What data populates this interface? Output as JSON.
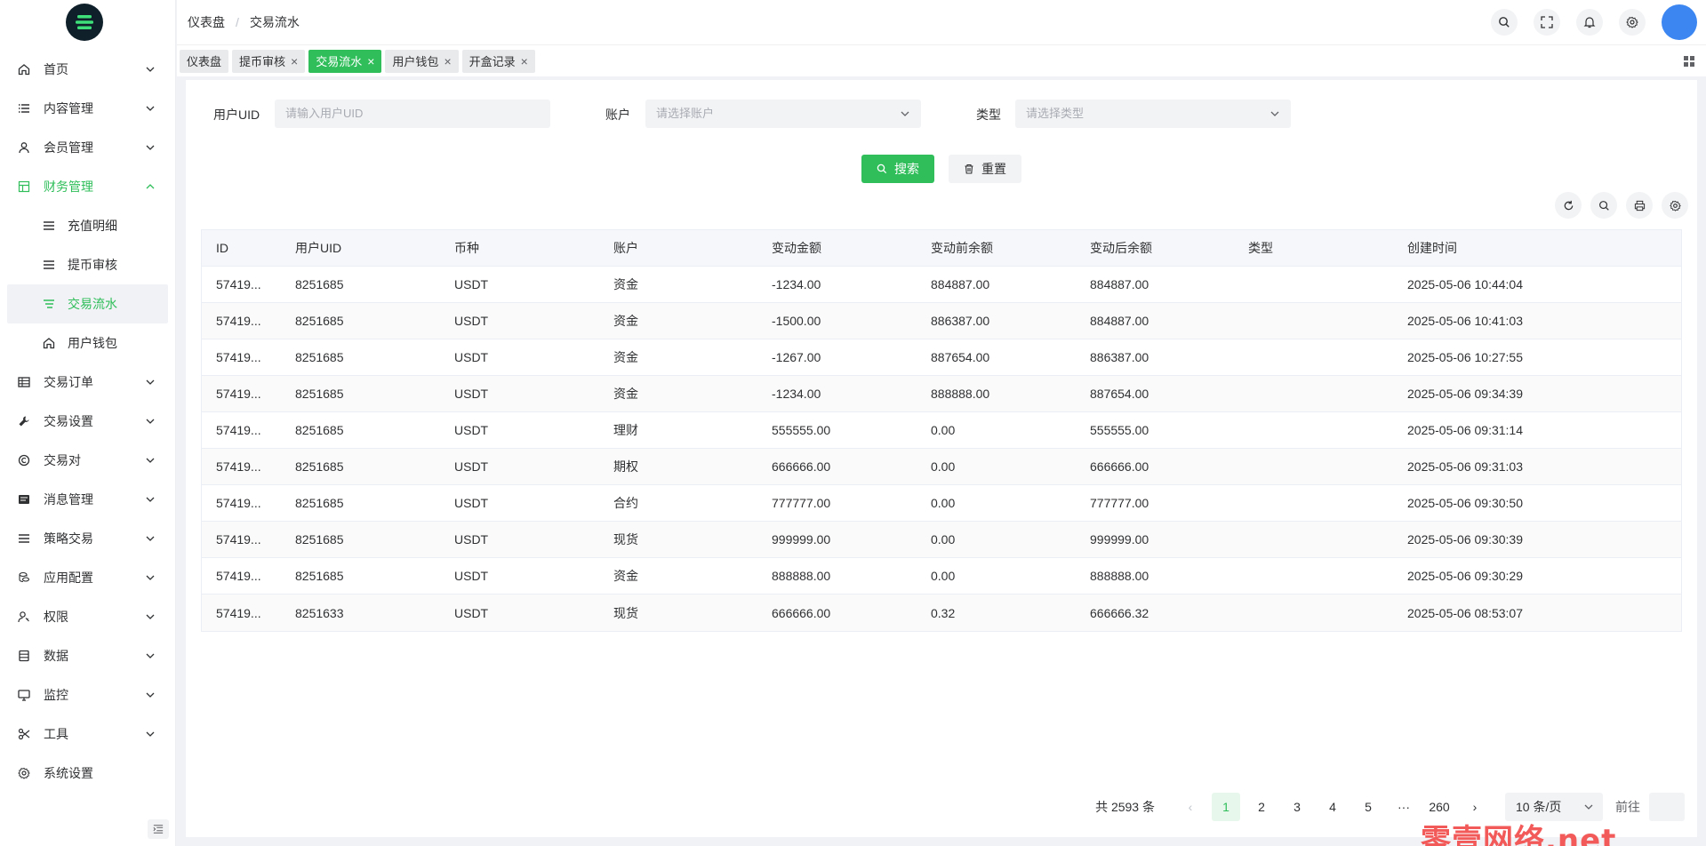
{
  "sidebar": {
    "menu": [
      {
        "label": "首页",
        "icon": "home-icon",
        "expanded": false
      },
      {
        "label": "内容管理",
        "icon": "list-icon",
        "expanded": false
      },
      {
        "label": "会员管理",
        "icon": "user-icon",
        "expanded": false
      },
      {
        "label": "财务管理",
        "icon": "finance-icon",
        "expanded": true,
        "active": true,
        "children": [
          {
            "label": "充值明细",
            "icon": "menu-lines-icon"
          },
          {
            "label": "提币审核",
            "icon": "menu-lines-icon"
          },
          {
            "label": "交易流水",
            "icon": "menu-lines-icon",
            "active": true
          },
          {
            "label": "用户钱包",
            "icon": "home-icon"
          }
        ]
      },
      {
        "label": "交易订单",
        "icon": "table-icon",
        "expanded": false
      },
      {
        "label": "交易设置",
        "icon": "wrench-icon",
        "expanded": false
      },
      {
        "label": "交易对",
        "icon": "copyright-icon",
        "expanded": false
      },
      {
        "label": "消息管理",
        "icon": "message-icon",
        "expanded": false
      },
      {
        "label": "策略交易",
        "icon": "lines-icon",
        "expanded": false
      },
      {
        "label": "应用配置",
        "icon": "coins-icon",
        "expanded": false
      },
      {
        "label": "权限",
        "icon": "user-key-icon",
        "expanded": false
      },
      {
        "label": "数据",
        "icon": "database-icon",
        "expanded": false
      },
      {
        "label": "监控",
        "icon": "monitor-icon",
        "expanded": false
      },
      {
        "label": "工具",
        "icon": "scissors-icon",
        "expanded": false
      },
      {
        "label": "系统设置",
        "icon": "gear-icon",
        "expanded": null
      }
    ]
  },
  "header": {
    "breadcrumb": [
      "仪表盘",
      "交易流水"
    ]
  },
  "tags": [
    {
      "label": "仪表盘",
      "closable": false,
      "active": false
    },
    {
      "label": "提币审核",
      "closable": true,
      "active": false
    },
    {
      "label": "交易流水",
      "closable": true,
      "active": true
    },
    {
      "label": "用户钱包",
      "closable": true,
      "active": false
    },
    {
      "label": "开盒记录",
      "closable": true,
      "active": false
    }
  ],
  "filters": {
    "uid_label": "用户UID",
    "uid_placeholder": "请输入用户UID",
    "account_label": "账户",
    "account_placeholder": "请选择账户",
    "type_label": "类型",
    "type_placeholder": "请选择类型",
    "search_label": "搜索",
    "reset_label": "重置"
  },
  "table": {
    "columns": [
      "ID",
      "用户UID",
      "币种",
      "账户",
      "变动金额",
      "变动前余额",
      "变动后余额",
      "类型",
      "创建时间"
    ],
    "rows": [
      [
        "57419...",
        "8251685",
        "USDT",
        "资金",
        "-1234.00",
        "884887.00",
        "884887.00",
        "",
        "2025-05-06 10:44:04"
      ],
      [
        "57419...",
        "8251685",
        "USDT",
        "资金",
        "-1500.00",
        "886387.00",
        "884887.00",
        "",
        "2025-05-06 10:41:03"
      ],
      [
        "57419...",
        "8251685",
        "USDT",
        "资金",
        "-1267.00",
        "887654.00",
        "886387.00",
        "",
        "2025-05-06 10:27:55"
      ],
      [
        "57419...",
        "8251685",
        "USDT",
        "资金",
        "-1234.00",
        "888888.00",
        "887654.00",
        "",
        "2025-05-06 09:34:39"
      ],
      [
        "57419...",
        "8251685",
        "USDT",
        "理财",
        "555555.00",
        "0.00",
        "555555.00",
        "",
        "2025-05-06 09:31:14"
      ],
      [
        "57419...",
        "8251685",
        "USDT",
        "期权",
        "666666.00",
        "0.00",
        "666666.00",
        "",
        "2025-05-06 09:31:03"
      ],
      [
        "57419...",
        "8251685",
        "USDT",
        "合约",
        "777777.00",
        "0.00",
        "777777.00",
        "",
        "2025-05-06 09:30:50"
      ],
      [
        "57419...",
        "8251685",
        "USDT",
        "现货",
        "999999.00",
        "0.00",
        "999999.00",
        "",
        "2025-05-06 09:30:39"
      ],
      [
        "57419...",
        "8251685",
        "USDT",
        "资金",
        "888888.00",
        "0.00",
        "888888.00",
        "",
        "2025-05-06 09:30:29"
      ],
      [
        "57419...",
        "8251633",
        "USDT",
        "现货",
        "666666.00",
        "0.32",
        "666666.32",
        "",
        "2025-05-06 08:53:07"
      ]
    ]
  },
  "pagination": {
    "total_text": "共 2593 条",
    "pages": [
      "1",
      "2",
      "3",
      "4",
      "5",
      "···",
      "260"
    ],
    "current": "1",
    "page_size": "10 条/页",
    "goto_label": "前往"
  },
  "watermark": "零壹网络.net",
  "colors": {
    "accent": "#2fbe5a",
    "avatar": "#3b86f0"
  }
}
